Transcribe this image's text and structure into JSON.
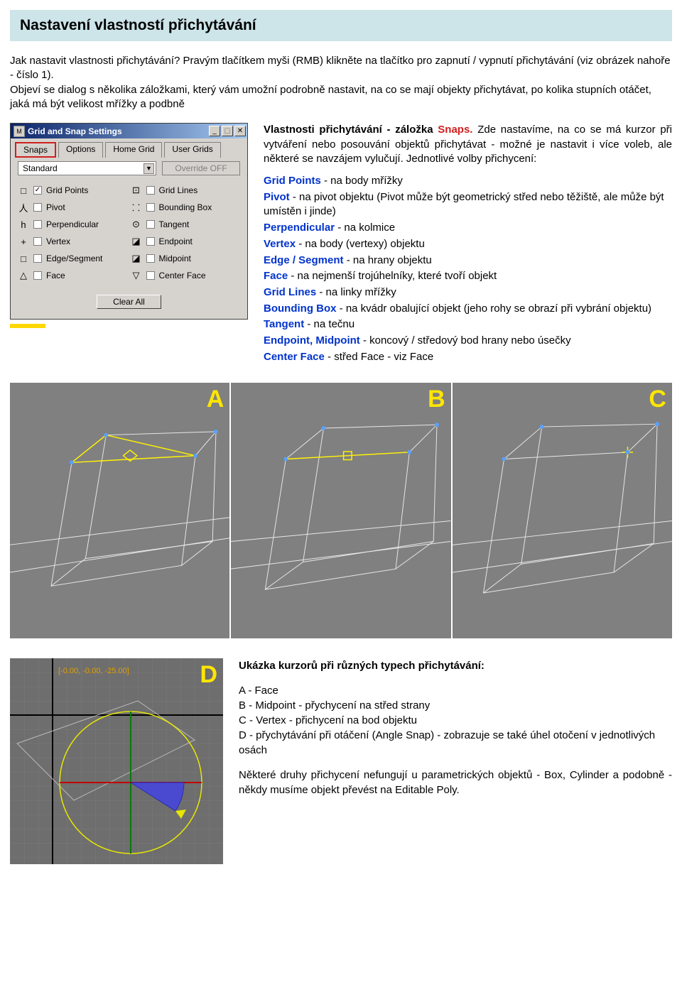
{
  "header": {
    "title": "Nastavení vlastností přichytávání"
  },
  "intro": {
    "p1": "Jak nastavit vlastnosti přichytávání? Pravým tlačítkem myši (RMB) klikněte na tlačítko pro zapnutí / vypnutí přichytávání (viz obrázek nahoře - číslo 1).",
    "p2": "Objeví se dialog s několika záložkami, který vám umožní podrobně nastavit, na co se mají objekty přichytávat, po kolika stupních otáčet, jaká má být velikost mřížky a podbně"
  },
  "dialog": {
    "title": "Grid and Snap Settings",
    "tabs": [
      "Snaps",
      "Options",
      "Home Grid",
      "User Grids"
    ],
    "dropdown_value": "Standard",
    "override_label": "Override OFF",
    "left_options": [
      {
        "icon": "□",
        "label": "Grid Points",
        "checked": true
      },
      {
        "icon": "人",
        "label": "Pivot",
        "checked": false
      },
      {
        "icon": "h",
        "label": "Perpendicular",
        "checked": false
      },
      {
        "icon": "+",
        "label": "Vertex",
        "checked": false
      },
      {
        "icon": "□",
        "label": "Edge/Segment",
        "checked": false
      },
      {
        "icon": "△",
        "label": "Face",
        "checked": false
      }
    ],
    "right_options": [
      {
        "icon": "⊡",
        "label": "Grid Lines",
        "checked": false
      },
      {
        "icon": "⸬",
        "label": "Bounding Box",
        "checked": false
      },
      {
        "icon": "⊙",
        "label": "Tangent",
        "checked": false
      },
      {
        "icon": "◪",
        "label": "Endpoint",
        "checked": false
      },
      {
        "icon": "◪",
        "label": "Midpoint",
        "checked": false
      },
      {
        "icon": "▽",
        "label": "Center Face",
        "checked": false
      }
    ],
    "clear_all": "Clear All"
  },
  "rightcol": {
    "heading_prefix": "Vlastnosti přichytávání  - záložka ",
    "heading_red": "Snaps.",
    "heading_rest": " Zde nastavíme, na co se má kurzor při vytváření nebo posouvání objektů přichytávat - možné je nastavit i více voleb, ale některé se navzájem vylučují. Jednotlivé volby přichycení:",
    "defs": [
      {
        "t": "Grid Points",
        "d": " - na body mřížky"
      },
      {
        "t": "Pivot",
        "d": " - na pivot objektu (Pivot může být geometrický střed nebo těžiště, ale může být umístěn i jinde)"
      },
      {
        "t": "Perpendicular",
        "d": " - na kolmice"
      },
      {
        "t": "Vertex",
        "d": " - na body (vertexy) objektu"
      },
      {
        "t": "Edge / Segment",
        "d": "  - na hrany objektu"
      },
      {
        "t": "Face",
        "d": " - na nejmenší trojúhelníky, které tvoří objekt"
      },
      {
        "t": "Grid Lines",
        "d": " - na linky mřížky"
      },
      {
        "t": "Bounding Box",
        "d": " - na kvádr obalující objekt (jeho rohy se obrazí při vybrání objektu)"
      },
      {
        "t": "Tangent",
        "d": " - na tečnu"
      },
      {
        "t": "Endpoint, Midpoint",
        "d": " - koncový / středový bod hrany nebo úsečky"
      },
      {
        "t": "Center Face",
        "d": " - střed Face - viz Face"
      }
    ]
  },
  "viewports": {
    "labels": [
      "A",
      "B",
      "C"
    ],
    "d_label": "D",
    "d_readout": "[-0.00, -0.00, -25.00]"
  },
  "bottom": {
    "title": "Ukázka kurzorů při různých typech přichytávání:",
    "lines": [
      "A - Face",
      "B - Midpoint - přychycení na střed strany",
      "C - Vertex - přichycení na bod objektu",
      "D - přychytávání při otáčení (Angle Snap) - zobrazuje se také úhel otočení v jednotlivých osách"
    ],
    "p2": "Některé druhy přichycení nefungují u parametrických objektů - Box, Cylinder a podobně - někdy musíme objekt převést na Editable Poly."
  }
}
